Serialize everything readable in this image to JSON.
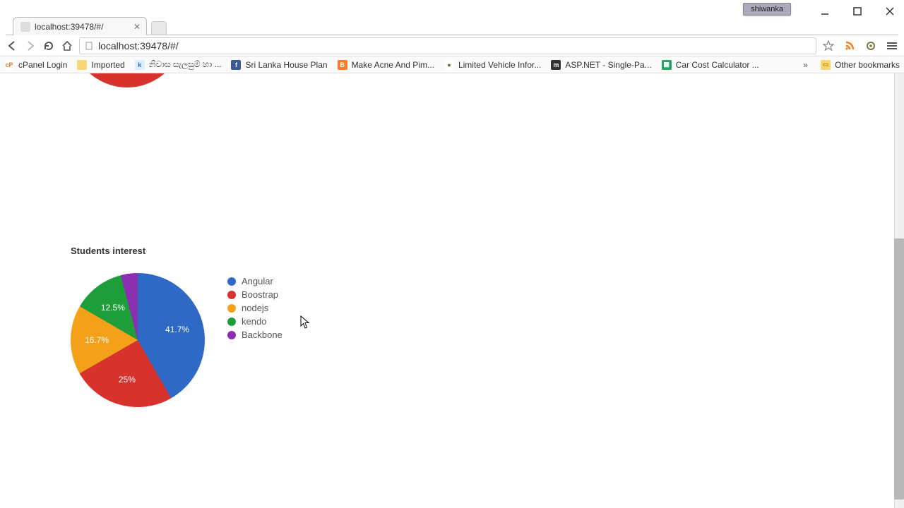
{
  "window": {
    "user_badge": "shiwanka"
  },
  "browser": {
    "tab_title": "localhost:39478/#/",
    "url": "localhost:39478/#/"
  },
  "bookmarks": [
    {
      "label": "cPanel Login",
      "icon_text": "cP",
      "icon_bg": "#fff",
      "icon_fg": "#e07b2a"
    },
    {
      "label": "Imported",
      "icon_text": "",
      "icon_bg": "#f7d774",
      "icon_fg": "#b58900",
      "folder": true
    },
    {
      "label": "නිවාස සැලසුම් හා ...",
      "icon_text": "k",
      "icon_bg": "#def",
      "icon_fg": "#36a"
    },
    {
      "label": "Sri Lanka House Plan",
      "icon_text": "f",
      "icon_bg": "#3b5998",
      "icon_fg": "#fff"
    },
    {
      "label": "Make Acne And Pim...",
      "icon_text": "B",
      "icon_bg": "#ff7b2b",
      "icon_fg": "#fff"
    },
    {
      "label": "Limited Vehicle Infor...",
      "icon_text": "●",
      "icon_bg": "#fff",
      "icon_fg": "#8a5a2a"
    },
    {
      "label": "ASP.NET - Single-Pa...",
      "icon_text": "m",
      "icon_bg": "#333",
      "icon_fg": "#fff"
    },
    {
      "label": "Car Cost Calculator ...",
      "icon_text": "▦",
      "icon_bg": "#23a366",
      "icon_fg": "#fff"
    }
  ],
  "other_bookmarks_label": "Other bookmarks",
  "chart_data": {
    "type": "pie",
    "title": "Students interest",
    "series": [
      {
        "name": "Angular",
        "value": 41.7,
        "label": "41.7%",
        "color": "#2f69c6"
      },
      {
        "name": "Boostrap",
        "value": 25.0,
        "label": "25%",
        "color": "#d8322d"
      },
      {
        "name": "nodejs",
        "value": 16.7,
        "label": "16.7%",
        "color": "#f4a11a"
      },
      {
        "name": "kendo",
        "value": 12.5,
        "label": "12.5%",
        "color": "#1e9e3b"
      },
      {
        "name": "Backbone",
        "value": 4.1,
        "label": "",
        "color": "#8a2fb0"
      }
    ]
  }
}
